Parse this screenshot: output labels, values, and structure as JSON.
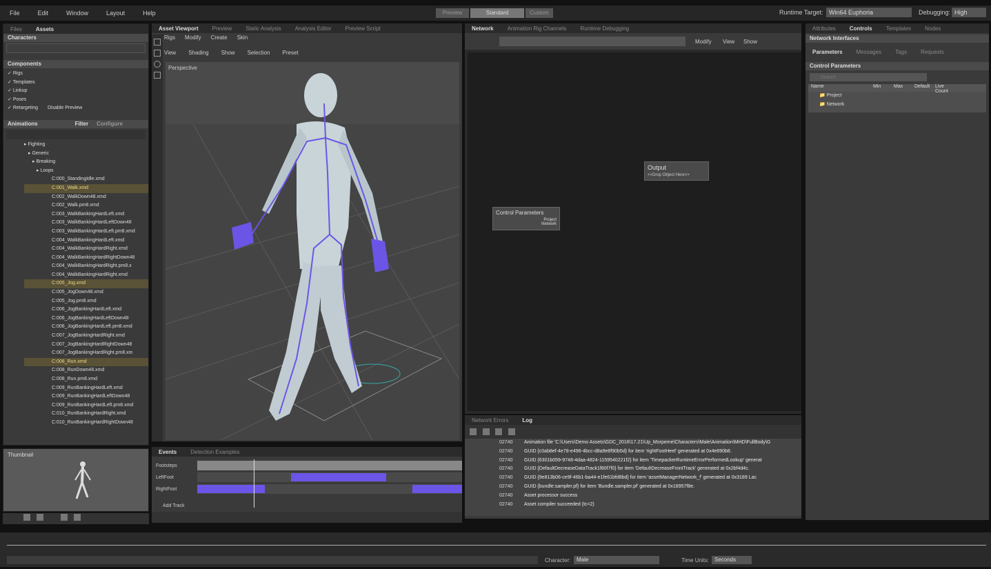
{
  "menu": {
    "file": "File",
    "edit": "Edit",
    "window": "Window",
    "layout": "Layout",
    "help": "Help"
  },
  "workspace": {
    "left": "Preview",
    "active": "Standard",
    "right": "Custom"
  },
  "runtime": {
    "label": "Runtime Target:",
    "value": "Win64 Euphoria",
    "debug_label": "Debugging:",
    "debug_value": "High"
  },
  "left_panel": {
    "tabs": [
      "Files",
      "Assets"
    ],
    "characters_header": "Characters",
    "components_header": "Components",
    "components": [
      "Rigs",
      "Templates",
      "Linkup",
      "Poses",
      "Retargeting"
    ],
    "disable_preview": "Disable Preview",
    "animations_header": "Animations",
    "filter_label": "Filter",
    "config_label": "Configure",
    "folders": [
      "Fighting",
      "Generic",
      "Breaking",
      "Loops"
    ],
    "files": [
      {
        "name": "C:000_StandingIdle.xmd",
        "hl": false
      },
      {
        "name": "C:001_Walk.xmd",
        "hl": true
      },
      {
        "name": "C:002_WalkDown48.xmd",
        "hl": false
      },
      {
        "name": "C:002_Walk.pm8.xmd",
        "hl": false
      },
      {
        "name": "C:003_WalkBankingHardLeft.xmd",
        "hl": false
      },
      {
        "name": "C:003_WalkBankingHardLeftDown48",
        "hl": false
      },
      {
        "name": "C:003_WalkBankingHardLeft.pm8.xmd",
        "hl": false
      },
      {
        "name": "C:004_WalkBankingHardLeft.xmd",
        "hl": false
      },
      {
        "name": "C:004_WalkBankingHardRight.xmd",
        "hl": false
      },
      {
        "name": "C:004_WalkBankingHardRightDown48",
        "hl": false
      },
      {
        "name": "C:004_WalkBankingHardRight.pm8.x",
        "hl": false
      },
      {
        "name": "C:004_WalkBankingHardRight.xmd",
        "hl": false
      },
      {
        "name": "C:005_Jog.xmd",
        "hl": true
      },
      {
        "name": "C:005_JogDown48.xmd",
        "hl": false
      },
      {
        "name": "C:005_Jog.pm8.xmd",
        "hl": false
      },
      {
        "name": "C:006_JogBankingHardLeft.xmd",
        "hl": false
      },
      {
        "name": "C:006_JogBankingHardLeftDown48",
        "hl": false
      },
      {
        "name": "C:006_JogBankingHardLeft.pm8.xmd",
        "hl": false
      },
      {
        "name": "C:007_JogBankingHardRight.xmd",
        "hl": false
      },
      {
        "name": "C:007_JogBankingHardRightDown48",
        "hl": false
      },
      {
        "name": "C:007_JogBankingHardRight.pm8.xm",
        "hl": false
      },
      {
        "name": "C:008_Run.xmd",
        "hl": true
      },
      {
        "name": "C:008_RunDown48.xmd",
        "hl": false
      },
      {
        "name": "C:008_Run.pm8.xmd",
        "hl": false
      },
      {
        "name": "C:009_RunBankingHardLeft.xmd",
        "hl": false
      },
      {
        "name": "C:009_RunBankingHardLeftDown48",
        "hl": false
      },
      {
        "name": "C:009_RunBankingHardLeft.pm8.xmd",
        "hl": false
      },
      {
        "name": "C:010_RunBankingHardRight.xmd",
        "hl": false
      },
      {
        "name": "C:010_RunBankingHardRightDown48",
        "hl": false
      }
    ],
    "thumbnail_label": "Thumbnail"
  },
  "viewport": {
    "tabs": [
      "Asset Viewport",
      "Preview",
      "Static Analysis",
      "Analysis Editor",
      "Preview Script"
    ],
    "menu1": [
      "Rigs",
      "Modify",
      "Create",
      "Skin"
    ],
    "menu2": [
      "View",
      "Shading",
      "Show",
      "Selection",
      "Preset"
    ],
    "label": "Perspective"
  },
  "events": {
    "tabs": [
      "Events",
      "Detection Examples"
    ],
    "tracks": [
      "Footsteps",
      "LeftFoot",
      "RightFoot"
    ],
    "add_track": "Add Track"
  },
  "network": {
    "tabs": [
      "Network",
      "Animation Rig Channels",
      "Runtime Debugging"
    ],
    "menu": [
      "Modify",
      "View",
      "Show"
    ],
    "output_title": "Output",
    "output_sub": "<<Drop Object Here>>",
    "cp_title": "Control Parameters",
    "cp_ports": [
      "Project",
      "Network"
    ]
  },
  "log": {
    "tabs": [
      "Network Errors",
      "Log"
    ],
    "rows": [
      {
        "code": "02740",
        "msg": "Animation file 'C:\\Users\\Demo Assets\\GDC_2016\\17.21\\Up_Morpeme\\Characters\\Male\\Animation\\MHD\\FullBody\\G"
      },
      {
        "code": "02740",
        "msg": "GUID {c0ab8ef-4e78-e496-4bcc-d8a9e8f90b5d} for item 'rightFootHeel' generated at 0x4e690b8."
      },
      {
        "code": "02740",
        "msg": "GUID {6301b059-9748-4daa-4824-1159540221f2} for item 'TimepackerRuntimeErrorPerformedLookup' generat"
      },
      {
        "code": "02740",
        "msg": "GUID {DefaultDecreaseDataTrack1f80f7f0} for item 'DefaultDecreaseFrontTrack' generated at 0x2bf4d4c."
      },
      {
        "code": "02740",
        "msg": "GUID {9e813b06-ce9f-46b1-ba44-e1fe61bfd8bd} for item 'assetManagerNetwork_f' generated at 0x3189 Lac"
      },
      {
        "code": "02740",
        "msg": "GUID {bundle:sampler.pf} for item 'Bundle.sampler.pf' generated at 0x18957f8e."
      },
      {
        "code": "02740",
        "msg": "Asset processor success"
      },
      {
        "code": "02740",
        "msg": "Asset compiler succeeded (tc=2)"
      }
    ]
  },
  "right_panel": {
    "tabs": [
      "Attributes",
      "Controls",
      "Templates",
      "Nodes"
    ],
    "net_interfaces": "Network Interfaces",
    "subtabs": [
      "Parameters",
      "Messages",
      "Tags",
      "Requests"
    ],
    "cp_header": "Control Parameters",
    "search_placeholder": "Search",
    "columns": [
      "Name",
      "Min",
      "Max",
      "Default",
      "Live Count"
    ],
    "tree": [
      "Project",
      "Network"
    ]
  },
  "bottom": {
    "character_label": "Character:",
    "character_value": "Male",
    "time_units_label": "Time Units:",
    "time_units_value": "Seconds"
  },
  "colors": {
    "accent": "#6a55e6",
    "highlight": "#eed98a"
  }
}
